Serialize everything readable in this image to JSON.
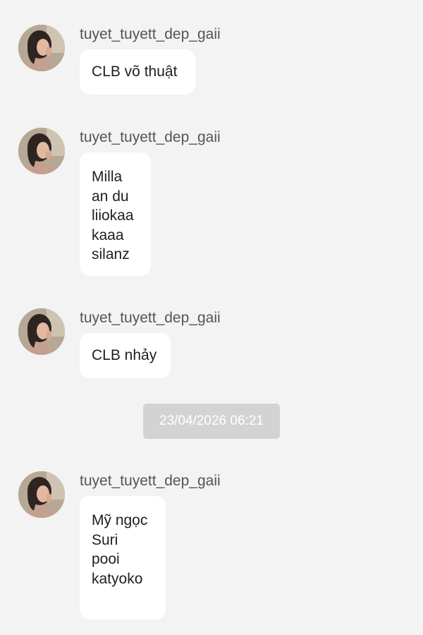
{
  "conversation": {
    "messages": [
      {
        "sender": "tuyet_tuyett_dep_gaii",
        "lines": [
          "CLB võ thuật"
        ]
      },
      {
        "sender": "tuyet_tuyett_dep_gaii",
        "lines": [
          "Milla",
          "an du",
          "liiokaa",
          "kaaa",
          "silanz"
        ]
      },
      {
        "sender": "tuyet_tuyett_dep_gaii",
        "lines": [
          "CLB nhảy"
        ]
      },
      {
        "sender": "tuyet_tuyett_dep_gaii",
        "lines": [
          "Mỹ ngọc",
          "Suri",
          "pooi",
          "katyoko",
          ""
        ]
      }
    ],
    "timestamp": "23/04/2026 06:21"
  },
  "icons": {
    "avatar": "user-avatar-photo"
  },
  "colors": {
    "background": "#f3f3f3",
    "bubble": "#ffffff",
    "timestamp_pill": "#d3d3d3",
    "sender_text": "#555555"
  }
}
